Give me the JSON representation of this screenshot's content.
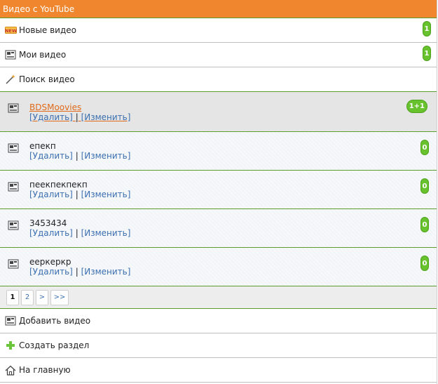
{
  "header": {
    "title": "Видео с YouTube"
  },
  "menu_top": [
    {
      "label": "Новые видео",
      "icon": "new-badge-icon",
      "count": "1"
    },
    {
      "label": "Мои видео",
      "icon": "video-camera-icon",
      "count": "1"
    },
    {
      "label": "Поиск видео",
      "icon": "magic-wand-icon"
    }
  ],
  "items": [
    {
      "name": "BDSMoovies",
      "count": "1+1"
    },
    {
      "name": "епекп",
      "count": "0"
    },
    {
      "name": "пеекпекпекп",
      "count": "0"
    },
    {
      "name": "3453434",
      "count": "0"
    },
    {
      "name": "ееркеркр",
      "count": "0"
    }
  ],
  "item_actions": {
    "delete": "[Удалить]",
    "separator": "|",
    "edit": "[Изменить]"
  },
  "pager": {
    "pages": [
      "1",
      "2"
    ],
    "next": ">",
    "last": ">>",
    "current": "1"
  },
  "menu_bottom": [
    {
      "label": "Добавить видео",
      "icon": "video-camera-icon"
    },
    {
      "label": "Создать раздел",
      "icon": "plus-icon"
    },
    {
      "label": "На главную",
      "icon": "home-icon"
    }
  ],
  "colors": {
    "accent": "#f0872e",
    "badge": "#67c22d",
    "link": "#3c6fb0",
    "divider": "#5d9b2c"
  }
}
